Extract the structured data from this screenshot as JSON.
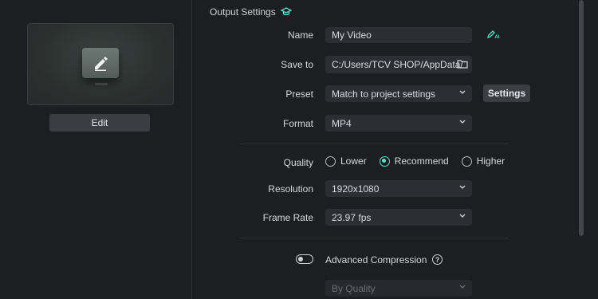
{
  "preview": {
    "edit_label": "Edit"
  },
  "section": {
    "title": "Output Settings",
    "icon": "graduation-cap-icon"
  },
  "name": {
    "label": "Name",
    "value": "My Video",
    "ai_icon": "ai-pen-icon"
  },
  "save_to": {
    "label": "Save to",
    "value": "C:/Users/TCV SHOP/AppData/",
    "icon": "folder-icon"
  },
  "preset": {
    "label": "Preset",
    "value": "Match to project settings",
    "settings_label": "Settings"
  },
  "format": {
    "label": "Format",
    "value": "MP4"
  },
  "quality": {
    "label": "Quality",
    "options": [
      "Lower",
      "Recommend",
      "Higher"
    ],
    "selected": "Recommend"
  },
  "resolution": {
    "label": "Resolution",
    "value": "1920x1080"
  },
  "frame_rate": {
    "label": "Frame Rate",
    "value": "23.97 fps"
  },
  "advanced": {
    "label": "Advanced Compression",
    "enabled": false,
    "help": "?",
    "mode_value": "By Quality"
  },
  "colors": {
    "accent": "#5de0c6",
    "background": "#1c1e21",
    "field": "#2b2e32",
    "button": "#3a3d42"
  }
}
